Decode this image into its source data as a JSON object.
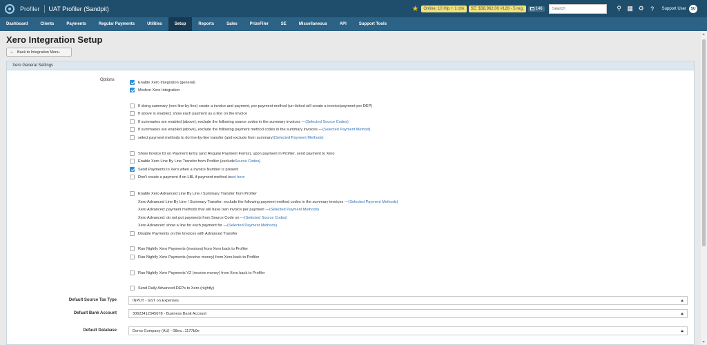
{
  "app": {
    "brand": "Profiler",
    "title": "UAT Profiler (Sandpit)"
  },
  "topbar": {
    "online_badge": "Online: 10 Hlp + 1 chk",
    "se_badge": "SE: $38,962.00 #128 - 5 reg.",
    "count": "146",
    "search_placeholder": "Search",
    "user_name": "Support User",
    "user_initials": "SU",
    "icons": [
      "star-icon",
      "pin-icon",
      "calendar-icon",
      "gear-icon",
      "help-icon"
    ]
  },
  "nav": {
    "items": [
      "Dashboard",
      "Clients",
      "Payments",
      "Regular Payments",
      "Utilities",
      "Setup",
      "Reports",
      "Sales",
      "PrizeFiler",
      "SE",
      "Miscellaneous",
      "API",
      "Support Tools"
    ],
    "active": "Setup"
  },
  "page": {
    "title": "Xero Integration Setup",
    "back_button": "Back to Integration Menu",
    "panel_title": "Xero General Settings",
    "options_label": "Options"
  },
  "options": [
    {
      "text": "Enable Xero Integration (general)",
      "link": "",
      "checked": true
    },
    {
      "text": "Modern Xero Integration",
      "link": "",
      "checked": true
    },
    {
      "text": "If doing summary (non-line-by-line) create a invoice and payment, per payment method (un-ticked will create a invoice/payment per DEP)",
      "link": "",
      "checked": false
    },
    {
      "text": "If above is enabled, show each payment as a line on the invoice",
      "link": "",
      "checked": false
    },
    {
      "text": "If summaries are enabled (above), exclude the following source codes in the summary invoices --- ",
      "link": "(Selected Source Codes)",
      "checked": false
    },
    {
      "text": "If summaries are enabled (above), exclude the following payment method codes in the summary invoices --- ",
      "link": "(Selected Payment Method)",
      "checked": false
    },
    {
      "text": "select payment methods to do line-by-line transfer (and exclude from summary) ",
      "link": "(Selected Payment Methods)",
      "checked": false
    },
    {
      "text": "Show Invoice ID on Payment Entry (and Regular Payment Forms), upon payment in Profiler, send payment to Xero",
      "link": "",
      "checked": false
    },
    {
      "text": "Enable Xero Line By Line Transfer from Profiler (exclude ",
      "link": "Source Codes",
      "suffix": ")",
      "checked": false
    },
    {
      "text": "Send Payments to Xero when a Invoice Number is present",
      "link": "",
      "checked": true
    },
    {
      "text": "Don't create a payment if on LBL if payment method is ",
      "link": "set here",
      "checked": false
    },
    {
      "text": "Enable Xero Advanced Line By Line / Summary Transfer from Profiler",
      "link": "",
      "checked": false
    },
    {
      "text": "Xero Advanced Line By Line / Summary Transfer: exclude the following payment method codes in the summary invoices --- ",
      "link": "(Selected Payment Methods)",
      "nobox": true
    },
    {
      "text": "Xero Advanced: payment methods that will have own invoice per payment --- ",
      "link": "(Selected Payment Methods)",
      "nobox": true
    },
    {
      "text": "Xero Advanced: do not put payments from Source Code on --- ",
      "link": "(Selected Source Codes)",
      "nobox": true
    },
    {
      "text": "Xero Advanced: show a line for each payment for --- ",
      "link": "(Selected Payment Methods)",
      "nobox": true
    },
    {
      "text": "Disable Payments on the Invoices with Advanced Transfer",
      "link": "",
      "checked": false
    },
    {
      "text": "Run Nightly Xero Payments (invoices) from Xero back to Profiler",
      "link": "",
      "checked": false
    },
    {
      "text": "Run Nightly Xero Payments (receive money) from Xero back to Profiler",
      "link": "",
      "checked": false
    },
    {
      "text": "Run Nightly Xero Payments V2 (receive money) from Xero back to Profiler",
      "link": "",
      "checked": false
    },
    {
      "text": "Send Daily Advanced DEPs to Xero (nightly)",
      "link": "",
      "checked": false
    }
  ],
  "fields": [
    {
      "label": "Default Source Tax Type",
      "value": "INPUT - GST on Expenses"
    },
    {
      "label": "Default Bank Account",
      "value": "30623412345678 - Business Bank Account"
    },
    {
      "label": "Default Database",
      "value": "Demo Company (AU) - 08ea...1177b0e"
    }
  ]
}
